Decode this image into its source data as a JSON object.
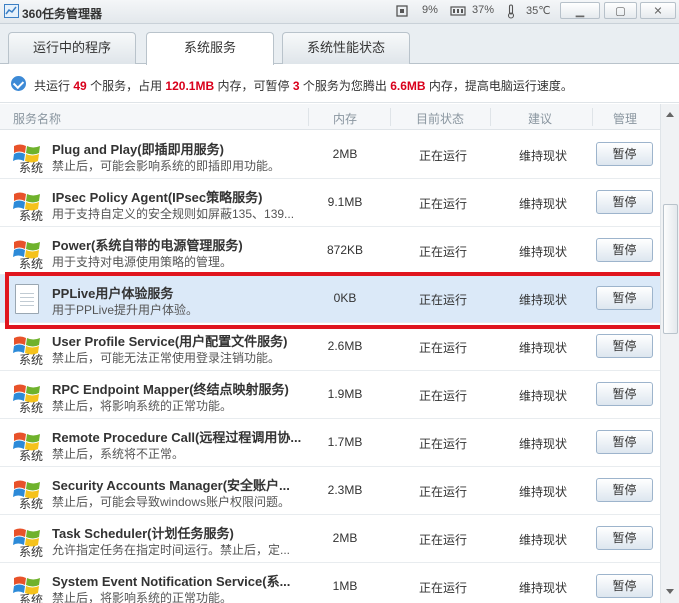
{
  "window": {
    "title": "360任务管理器",
    "cpu": "9%",
    "memory": "37%",
    "temperature": "35℃"
  },
  "tabs": [
    {
      "label": "运行中的程序",
      "active": false
    },
    {
      "label": "系统服务",
      "active": true
    },
    {
      "label": "系统性能状态",
      "active": false
    }
  ],
  "summary": {
    "p1": "共运行",
    "running_count": "49",
    "p2": "个服务，占用",
    "memory_used": "120.1MB",
    "p3": "内存，可暂停",
    "pausable_count": "3",
    "p4": "个服务为您腾出",
    "freeable": "6.6MB",
    "p5": "内存，提高电脑运行速度。"
  },
  "columns": {
    "name": "服务名称",
    "memory": "内存",
    "status": "目前状态",
    "advice": "建议",
    "manage": "管理"
  },
  "icon_label": "系统",
  "button_label": "暂停",
  "rows": [
    {
      "title": "Plug and Play(即插即用服务)",
      "desc": "禁止后，可能会影响系统的即插即用功能。",
      "memory": "2MB",
      "status": "正在运行",
      "advice": "维持现状",
      "icon": "windows-flag"
    },
    {
      "title": "IPsec Policy Agent(IPsec策略服务)",
      "desc": "用于支持自定义的安全规则如屏蔽135、139...",
      "memory": "9.1MB",
      "status": "正在运行",
      "advice": "维持现状",
      "icon": "windows-flag"
    },
    {
      "title": "Power(系统自带的电源管理服务)",
      "desc": "用于支持对电源使用策略的管理。",
      "memory": "872KB",
      "status": "正在运行",
      "advice": "维持现状",
      "icon": "windows-flag"
    },
    {
      "title": "PPLive用户体验服务",
      "desc": "用于PPLive提升用户体验。",
      "memory": "0KB",
      "status": "正在运行",
      "advice": "维持现状",
      "icon": "document"
    },
    {
      "title": "User Profile Service(用户配置文件服务)",
      "desc": "禁止后，可能无法正常使用登录注销功能。",
      "memory": "2.6MB",
      "status": "正在运行",
      "advice": "维持现状",
      "icon": "windows-flag"
    },
    {
      "title": "RPC Endpoint Mapper(终结点映射服务)",
      "desc": "禁止后，将影响系统的正常功能。",
      "memory": "1.9MB",
      "status": "正在运行",
      "advice": "维持现状",
      "icon": "windows-flag"
    },
    {
      "title": "Remote Procedure Call(远程过程调用协...",
      "desc": "禁止后，系统将不正常。",
      "memory": "1.7MB",
      "status": "正在运行",
      "advice": "维持现状",
      "icon": "windows-flag"
    },
    {
      "title": "Security Accounts Manager(安全账户...",
      "desc": "禁止后，可能会导致windows账户权限问题。",
      "memory": "2.3MB",
      "status": "正在运行",
      "advice": "维持现状",
      "icon": "windows-flag"
    },
    {
      "title": "Task Scheduler(计划任务服务)",
      "desc": "允许指定任务在指定时间运行。禁止后，定...",
      "memory": "2MB",
      "status": "正在运行",
      "advice": "维持现状",
      "icon": "windows-flag"
    },
    {
      "title": "System Event Notification Service(系...",
      "desc": "禁止后，将影响系统的正常功能。",
      "memory": "1MB",
      "status": "正在运行",
      "advice": "维持现状",
      "icon": "windows-flag"
    }
  ],
  "colors": {
    "highlight_text": "#d9001b",
    "selection_border": "#e0151e",
    "selected_row": "#dbe9f8"
  }
}
